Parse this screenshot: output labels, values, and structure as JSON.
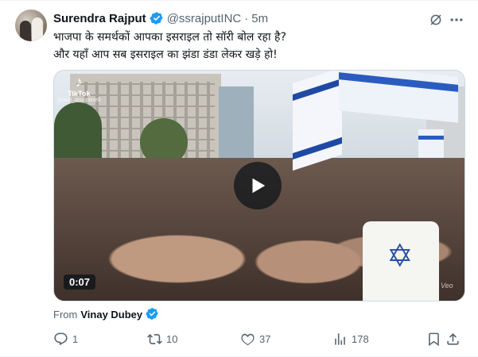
{
  "author": {
    "name": "Surendra Rajput",
    "handle": "@ssrajputINC",
    "separator": "·",
    "time": "5m"
  },
  "tweet": {
    "lines": [
      "भाजपा के समर्थकों आपका इसराइल तो सॉरी बोल रहा है?",
      "और यहाँ आप सब इसराइल का झंडा डंडा लेकर खड़े हो!"
    ]
  },
  "media": {
    "watermark_label": "TikTok",
    "watermark_user": "@just_discipline0",
    "duration": "0:07",
    "corner_mark": "Veo"
  },
  "attribution": {
    "label": "From",
    "name": "Vinay Dubey"
  },
  "actions": {
    "replies": "1",
    "reposts": "10",
    "likes": "37",
    "views": "178"
  },
  "colors": {
    "verified": "#1d9bf0",
    "secondary_text": "#536471",
    "primary_text": "#0f1419"
  },
  "icons": [
    "verified-badge-icon",
    "grok-icon",
    "more-icon",
    "tiktok-icon",
    "play-icon",
    "reply-icon",
    "repost-icon",
    "like-icon",
    "views-icon",
    "bookmark-icon",
    "share-icon"
  ]
}
